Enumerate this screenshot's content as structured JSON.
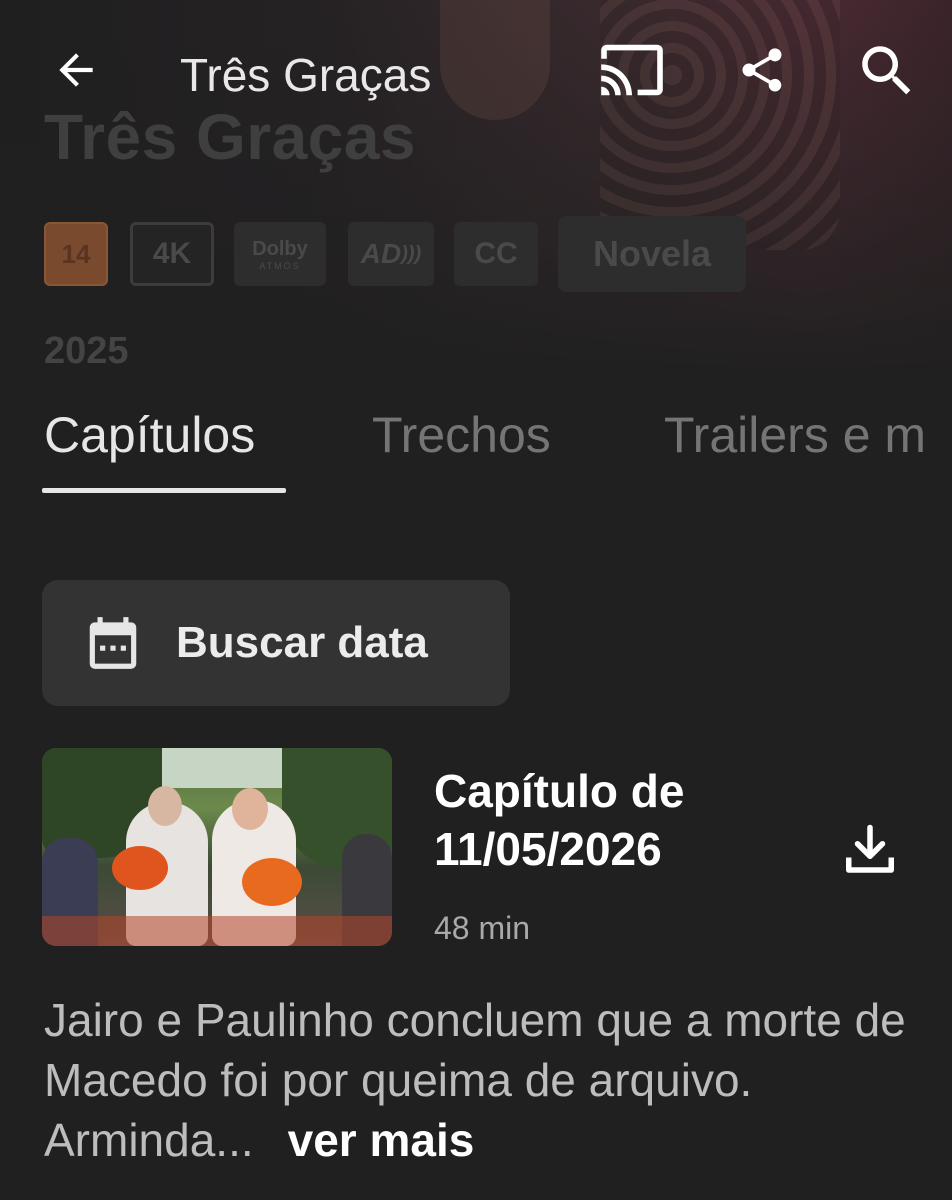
{
  "app_bar": {
    "title": "Três Graças",
    "back_icon": "arrow-left-icon",
    "cast_icon": "cast-icon",
    "share_icon": "share-icon",
    "search_icon": "search-icon"
  },
  "hero": {
    "title": "Três Graças",
    "badges": {
      "age_rating": "14",
      "quality": "4K",
      "dolby": "Dolby",
      "dolby_sub": "ATMOS",
      "audio_description": "AD",
      "captions": "CC",
      "genre": "Novela"
    },
    "year": "2025"
  },
  "tabs": [
    {
      "label": "Capítulos",
      "selected": true
    },
    {
      "label": "Trechos",
      "selected": false
    },
    {
      "label": "Trailers e m",
      "selected": false
    }
  ],
  "date_search": {
    "label": "Buscar data",
    "icon": "calendar-icon"
  },
  "episode": {
    "title": "Capítulo de 11/05/2026",
    "duration": "48 min",
    "download_icon": "download-icon",
    "description": "Jairo e Paulinho concluem que a morte de Macedo foi por queima de arquivo. Arminda...",
    "more_label": "ver mais"
  },
  "colors": {
    "background": "#202020",
    "card": "#333333",
    "tab_active": "#e6e6e6",
    "tab_inactive": "#757575",
    "age_rating": "#7a4a2e"
  }
}
